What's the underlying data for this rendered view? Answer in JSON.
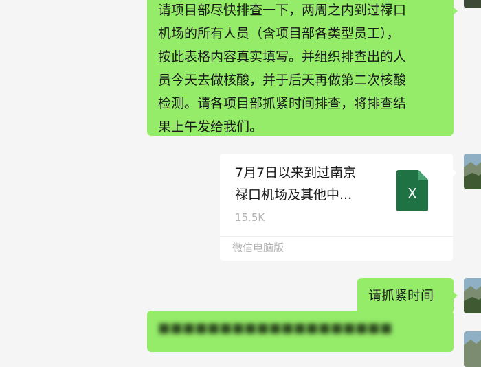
{
  "messages": {
    "long_text": {
      "lines": [
        "请项目部尽快排查一下，两周之内到过禄口",
        "机场的所有人员（含项目部各类型员工），",
        "按此表格内容真实填写。并组织排查出的人",
        "员今天去做核酸，并于后天再做第二次核酸",
        "检测。请各项目部抓紧时间排查，将排查结",
        "果上午发给我们。"
      ]
    },
    "file": {
      "name_line1": "7月7日以来到过南京",
      "name_line2": "禄口机场及其他中...",
      "size": "15.5K",
      "source": "微信电脑版",
      "icon": "excel-file-icon",
      "icon_letter": "X",
      "icon_color": "#1f7244"
    },
    "short_text": "请抓紧时间"
  },
  "colors": {
    "background": "#f5f5f5",
    "sent_bubble": "#95ec69",
    "card": "#ffffff",
    "muted_text": "#b2b2b2"
  }
}
